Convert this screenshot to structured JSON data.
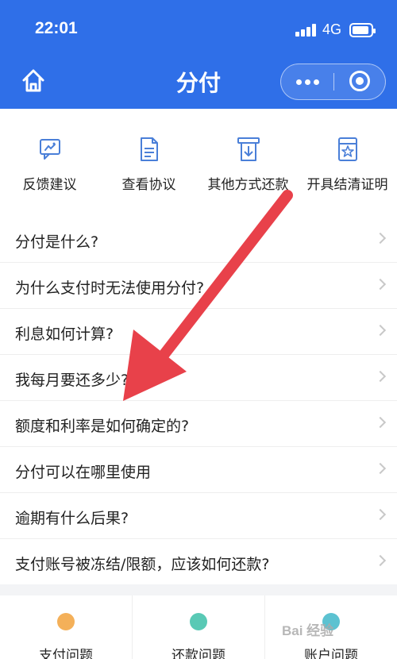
{
  "status_bar": {
    "time": "22:01",
    "network": "4G",
    "battery_level_pct": 90
  },
  "nav": {
    "title": "分付",
    "home_icon": "home-icon",
    "more_icon": "more-dots-icon",
    "close_icon": "target-close-icon"
  },
  "quick_actions": [
    {
      "label": "反馈建议",
      "icon": "feedback-icon"
    },
    {
      "label": "查看协议",
      "icon": "document-icon"
    },
    {
      "label": "其他方式还款",
      "icon": "repay-icon"
    },
    {
      "label": "开具结清证明",
      "icon": "certificate-icon"
    }
  ],
  "faq": [
    "分付是什么?",
    "为什么支付时无法使用分付?",
    "利息如何计算?",
    "我每月要还多少?",
    "额度和利率是如何确定的?",
    "分付可以在哪里使用",
    "逾期有什么后果?",
    "支付账号被冻结/限额，应该如何还款?"
  ],
  "bottom_tabs": [
    {
      "label": "支付问题",
      "icon": "payment-issue-icon",
      "color": "#f2a23c"
    },
    {
      "label": "还款问题",
      "icon": "repayment-issue-icon",
      "color": "#3cc0a8"
    },
    {
      "label": "账户问题",
      "icon": "account-issue-icon",
      "color": "#3fb7c9"
    }
  ],
  "watermark": "Bai 经验",
  "colors": {
    "primary": "#2f6fe8",
    "icon_blue": "#4a7fd8",
    "arrow_red": "#e8414a"
  }
}
